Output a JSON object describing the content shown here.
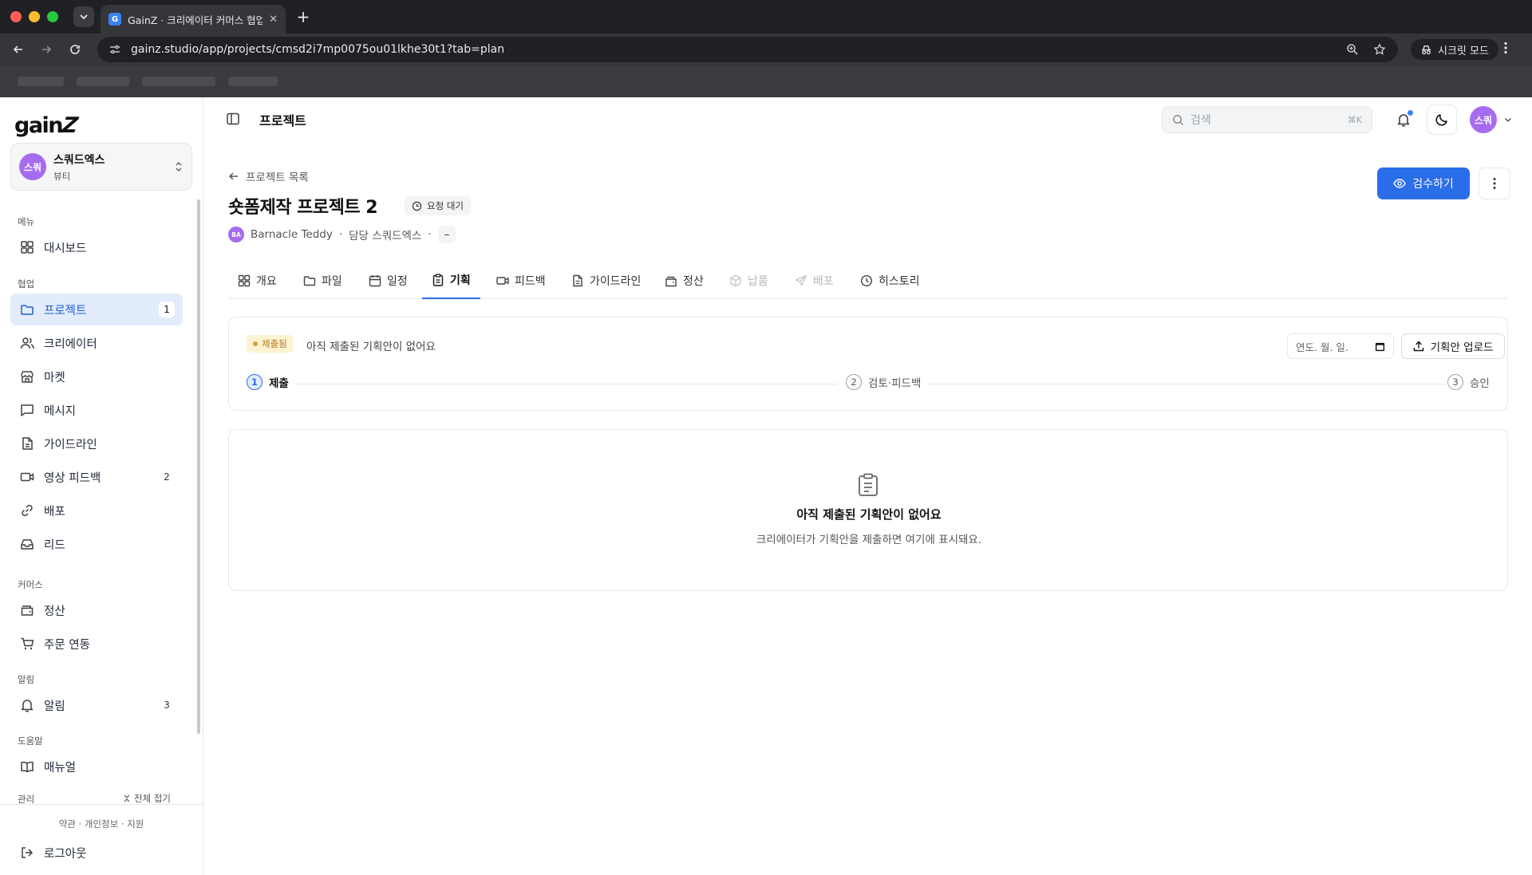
{
  "browser": {
    "tab_title": "GainZ · 크리에이터 커머스 협업 C",
    "favicon_letter": "G",
    "url": "gainz.studio/app/projects/cmsd2i7mp0075ou01lkhe30t1?tab=plan",
    "incognito_label": "시크릿 모드"
  },
  "sidebar": {
    "logo_text": "gain",
    "logo_mark": "Z",
    "workspace": {
      "avatar": "스쿼",
      "name": "스쿼드엑스",
      "category": "뷰티"
    },
    "sections": {
      "menu": "메뉴",
      "collab": "협업",
      "commerce": "커머스",
      "alerts": "알림",
      "help": "도움말",
      "admin": "관리"
    },
    "items": {
      "dashboard": "대시보드",
      "project": "프로젝트",
      "project_badge": "1",
      "creator": "크리에이터",
      "market": "마켓",
      "message": "메시지",
      "guideline": "가이드라인",
      "video_feedback": "영상 피드백",
      "video_feedback_badge": "2",
      "distribution": "배포",
      "lead": "리드",
      "settlement": "정산",
      "order_sync": "주문 연동",
      "notifications": "알림",
      "notifications_badge": "3",
      "manual": "매뉴얼"
    },
    "collapse_all": "전체 접기",
    "legal": "약관 · 개인정보 · 지원",
    "logout": "로그아웃"
  },
  "topbar": {
    "title": "프로젝트",
    "search_placeholder": "검색",
    "search_shortcut": "⌘K",
    "user_avatar": "스쿼"
  },
  "project": {
    "back_label": "프로젝트 목록",
    "title": "숏폼제작 프로젝트 2",
    "status": "요청 대기",
    "creator_initials": "BA",
    "creator_name": "Barnacle Teddy",
    "separator": "·",
    "manager": "담당 스쿼드엑스",
    "manager_extra": "–",
    "review_button": "검수하기"
  },
  "tabs": [
    {
      "label": "개요",
      "icon": "grid-icon"
    },
    {
      "label": "파일",
      "icon": "folder-icon"
    },
    {
      "label": "일정",
      "icon": "calendar-icon"
    },
    {
      "label": "기획",
      "icon": "clipboard-icon"
    },
    {
      "label": "피드백",
      "icon": "video-icon"
    },
    {
      "label": "가이드라인",
      "icon": "document-icon"
    },
    {
      "label": "정산",
      "icon": "wallet-icon"
    },
    {
      "label": "납품",
      "icon": "box-icon"
    },
    {
      "label": "배포",
      "icon": "send-icon"
    },
    {
      "label": "히스토리",
      "icon": "clock-icon"
    }
  ],
  "plan": {
    "status_badge": "제출됨",
    "status_message": "아직 제출된 기획안이 없어요",
    "date_placeholder": "연도. 월. 일.",
    "upload_button": "기획안 업로드",
    "steps": [
      {
        "num": "1",
        "label": "제출"
      },
      {
        "num": "2",
        "label": "검토·피드백"
      },
      {
        "num": "3",
        "label": "승인"
      }
    ],
    "empty_title": "아직 제출된 기획안이 없어요",
    "empty_desc": "크리에이터가 기획안을 제출하면 여기에 표시돼요."
  },
  "colors": {
    "accent": "#2a6de8",
    "avatar": "#a66cf0",
    "active_nav_bg": "#e3ecfb",
    "submitted_badge": "#fdf3d3"
  }
}
